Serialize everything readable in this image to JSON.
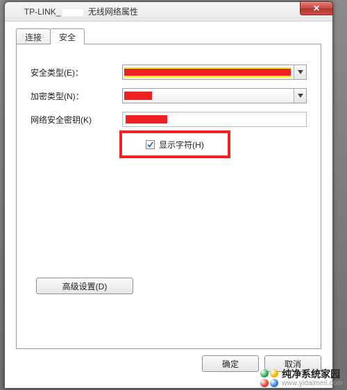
{
  "window": {
    "title_prefix": "TP-LINK_",
    "title_suffix": " 无线网络属性",
    "close_glyph": "✕"
  },
  "tabs": {
    "connect": "连接",
    "security": "安全"
  },
  "form": {
    "security_type_label": "安全类型(E)：",
    "encryption_type_label": "加密类型(N)：",
    "network_key_label": "网络安全密钥(K)",
    "show_chars_label": "显示字符(H)"
  },
  "buttons": {
    "advanced": "高级设置(D)",
    "ok": "确定",
    "cancel": "取消"
  },
  "watermark": {
    "zh": "纯净系统家园",
    "en": "www.yidaimeil.com"
  },
  "icons": {
    "dropdown_arrow": "chevron-down",
    "check": "check"
  }
}
